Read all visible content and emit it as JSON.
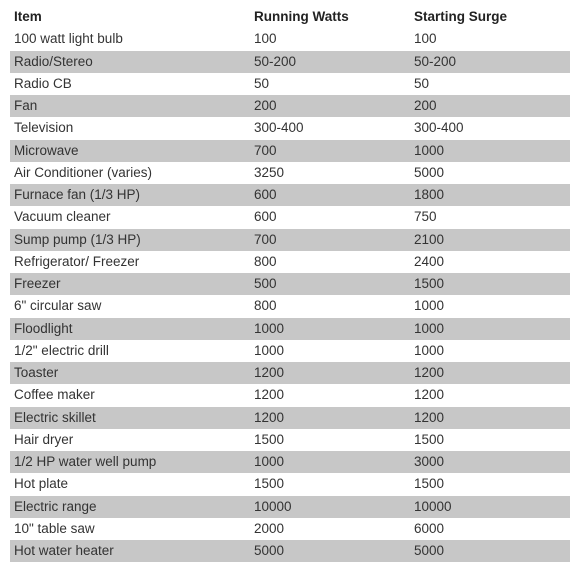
{
  "table": {
    "headers": {
      "item": "Item",
      "running": "Running Watts",
      "surge": "Starting Surge"
    },
    "rows": [
      {
        "item": "100 watt light bulb",
        "running": "100",
        "surge": "100"
      },
      {
        "item": "Radio/Stereo",
        "running": "50-200",
        "surge": "50-200"
      },
      {
        "item": "Radio CB",
        "running": "50",
        "surge": "50"
      },
      {
        "item": "Fan",
        "running": "200",
        "surge": "200"
      },
      {
        "item": "Television",
        "running": "300-400",
        "surge": "300-400"
      },
      {
        "item": "Microwave",
        "running": "700",
        "surge": "1000"
      },
      {
        "item": "Air Conditioner (varies)",
        "running": "3250",
        "surge": "5000"
      },
      {
        "item": "Furnace fan (1/3 HP)",
        "running": "600",
        "surge": "1800"
      },
      {
        "item": "Vacuum cleaner",
        "running": "600",
        "surge": "750"
      },
      {
        "item": "Sump pump (1/3 HP)",
        "running": "700",
        "surge": "2100"
      },
      {
        "item": "Refrigerator/ Freezer",
        "running": "800",
        "surge": "2400"
      },
      {
        "item": "Freezer",
        "running": "500",
        "surge": "1500"
      },
      {
        "item": "6\" circular saw",
        "running": "800",
        "surge": "1000"
      },
      {
        "item": "Floodlight",
        "running": "1000",
        "surge": "1000"
      },
      {
        "item": "1/2\" electric drill",
        "running": "1000",
        "surge": "1000"
      },
      {
        "item": "Toaster",
        "running": "1200",
        "surge": "1200"
      },
      {
        "item": "Coffee maker",
        "running": "1200",
        "surge": "1200"
      },
      {
        "item": "Electric skillet",
        "running": "1200",
        "surge": "1200"
      },
      {
        "item": "Hair dryer",
        "running": "1500",
        "surge": "1500"
      },
      {
        "item": "1/2 HP water well pump",
        "running": "1000",
        "surge": "3000"
      },
      {
        "item": "Hot plate",
        "running": "1500",
        "surge": "1500"
      },
      {
        "item": "Electric range",
        "running": "10000",
        "surge": "10000"
      },
      {
        "item": "10\" table saw",
        "running": "2000",
        "surge": "6000"
      },
      {
        "item": "Hot water heater",
        "running": "5000",
        "surge": "5000"
      }
    ]
  }
}
